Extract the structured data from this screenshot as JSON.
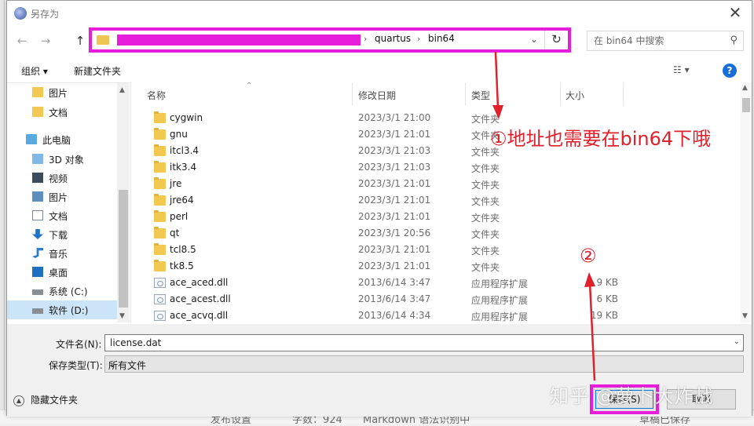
{
  "window": {
    "title": "另存为",
    "close": "✕"
  },
  "nav": {
    "back": "←",
    "forward": "→",
    "up": "↑"
  },
  "address": {
    "segments": [
      "quartus",
      "bin64"
    ],
    "separator": "›",
    "redaction_color": "#e81ddb",
    "refresh": "↻",
    "dropdown": "⌄"
  },
  "search": {
    "placeholder": "在 bin64 中搜索",
    "icon": "search-icon"
  },
  "toolbar": {
    "organize": "组织 ▾",
    "new_folder": "新建文件夹",
    "view": "☷ ▾",
    "help": "?"
  },
  "sidebar": {
    "items": [
      {
        "label": "图片",
        "icon": "folder-icon"
      },
      {
        "label": "文档",
        "icon": "folder-icon"
      },
      {
        "label": "此电脑",
        "icon": "computer-icon"
      },
      {
        "label": "3D 对象",
        "icon": "3d-objects-icon"
      },
      {
        "label": "视频",
        "icon": "video-icon"
      },
      {
        "label": "图片",
        "icon": "pictures-icon"
      },
      {
        "label": "文档",
        "icon": "documents-icon"
      },
      {
        "label": "下载",
        "icon": "download-icon"
      },
      {
        "label": "音乐",
        "icon": "music-icon"
      },
      {
        "label": "桌面",
        "icon": "desktop-icon"
      },
      {
        "label": "系统 (C:)",
        "icon": "drive-icon"
      },
      {
        "label": "软件 (D:)",
        "icon": "drive-icon",
        "selected": true
      }
    ]
  },
  "columns": {
    "name": "名称",
    "date": "修改日期",
    "type": "类型",
    "size": "大小"
  },
  "files": [
    {
      "name": "cygwin",
      "date": "2023/3/1 21:00",
      "type": "文件夹",
      "size": "",
      "kind": "folder"
    },
    {
      "name": "gnu",
      "date": "2023/3/1 21:01",
      "type": "文件夹",
      "size": "",
      "kind": "folder"
    },
    {
      "name": "itcl3.4",
      "date": "2023/3/1 21:03",
      "type": "文件夹",
      "size": "",
      "kind": "folder"
    },
    {
      "name": "itk3.4",
      "date": "2023/3/1 21:03",
      "type": "文件夹",
      "size": "",
      "kind": "folder"
    },
    {
      "name": "jre",
      "date": "2023/3/1 21:01",
      "type": "文件夹",
      "size": "",
      "kind": "folder"
    },
    {
      "name": "jre64",
      "date": "2023/3/1 21:01",
      "type": "文件夹",
      "size": "",
      "kind": "folder"
    },
    {
      "name": "perl",
      "date": "2023/3/1 21:01",
      "type": "文件夹",
      "size": "",
      "kind": "folder"
    },
    {
      "name": "qt",
      "date": "2023/3/1 20:56",
      "type": "文件夹",
      "size": "",
      "kind": "folder"
    },
    {
      "name": "tcl8.5",
      "date": "2023/3/1 21:01",
      "type": "文件夹",
      "size": "",
      "kind": "folder"
    },
    {
      "name": "tk8.5",
      "date": "2023/3/1 21:01",
      "type": "文件夹",
      "size": "",
      "kind": "folder"
    },
    {
      "name": "ace_aced.dll",
      "date": "2013/6/14 3:47",
      "type": "应用程序扩展",
      "size": "9 KB",
      "kind": "dll"
    },
    {
      "name": "ace_acest.dll",
      "date": "2013/6/14 3:47",
      "type": "应用程序扩展",
      "size": "6 KB",
      "kind": "dll"
    },
    {
      "name": "ace_acvq.dll",
      "date": "2013/6/14 4:34",
      "type": "应用程序扩展",
      "size": "19 KB",
      "kind": "dll"
    }
  ],
  "fields": {
    "filename_label": "文件名(N):",
    "filename_value": "license.dat",
    "filetype_label": "保存类型(T):",
    "filetype_value": "所有文件"
  },
  "footer": {
    "hide_folders": "隐藏文件夹",
    "save": "保存(S)",
    "cancel": "取消"
  },
  "annotations": {
    "note1": "①地址也需要在bin64下哦",
    "note2": "②",
    "color": "#e0202b",
    "highlight_color": "#e81ddb"
  },
  "watermark": "知乎 @萝卜大炸战",
  "background_app": {
    "status": [
      "发布设置",
      "字数：924",
      "Markdown 语法识别中",
      "草稿已保存"
    ]
  }
}
